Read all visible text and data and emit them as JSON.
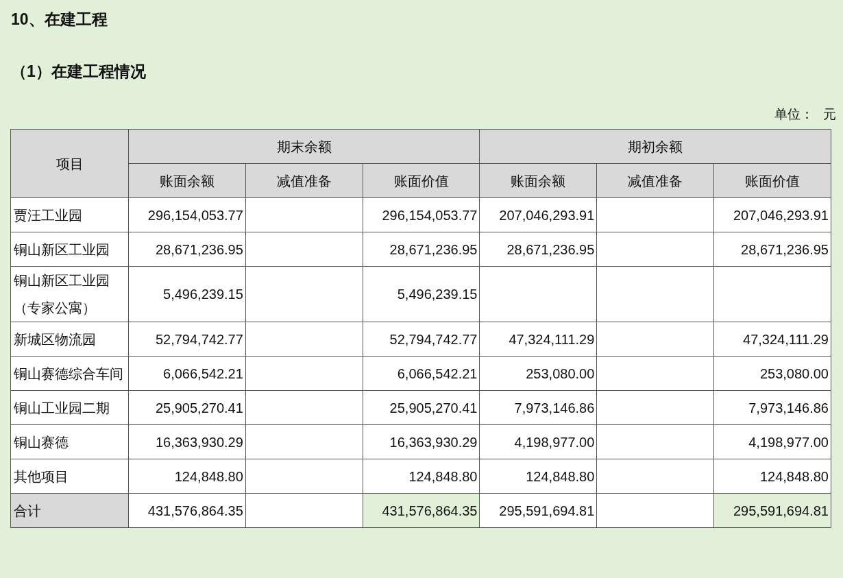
{
  "section_title": "10、在建工程",
  "subsection_title": "（1）在建工程情况",
  "unit": {
    "label": "单位：",
    "value": "元"
  },
  "table": {
    "item_header": "项目",
    "groups": [
      {
        "title": "期末余额",
        "columns": [
          "账面余额",
          "减值准备",
          "账面价值"
        ]
      },
      {
        "title": "期初余额",
        "columns": [
          "账面余额",
          "减值准备",
          "账面价值"
        ]
      }
    ],
    "rows": [
      {
        "kind": "normal",
        "item": "贾汪工业园",
        "cells": [
          "296,154,053.77",
          null,
          "296,154,053.77",
          "207,046,293.91",
          null,
          "207,046,293.91"
        ]
      },
      {
        "kind": "normal",
        "item": "铜山新区工业园",
        "cells": [
          "28,671,236.95",
          null,
          "28,671,236.95",
          "28,671,236.95",
          null,
          "28,671,236.95"
        ]
      },
      {
        "kind": "normal",
        "item": "铜山新区工业园（专家公寓）",
        "cells": [
          "5,496,239.15",
          null,
          "5,496,239.15",
          null,
          null,
          null
        ]
      },
      {
        "kind": "normal",
        "item": "新城区物流园",
        "cells": [
          "52,794,742.77",
          null,
          "52,794,742.77",
          "47,324,111.29",
          null,
          "47,324,111.29"
        ]
      },
      {
        "kind": "normal",
        "item": "铜山赛德综合车间",
        "cells": [
          "6,066,542.21",
          null,
          "6,066,542.21",
          "253,080.00",
          null,
          "253,080.00"
        ]
      },
      {
        "kind": "normal",
        "item": "铜山工业园二期",
        "cells": [
          "25,905,270.41",
          null,
          "25,905,270.41",
          "7,973,146.86",
          null,
          "7,973,146.86"
        ]
      },
      {
        "kind": "normal",
        "item": "铜山赛德",
        "cells": [
          "16,363,930.29",
          null,
          "16,363,930.29",
          "4,198,977.00",
          null,
          "4,198,977.00"
        ]
      },
      {
        "kind": "normal",
        "item": "其他项目",
        "cells": [
          "124,848.80",
          null,
          "124,848.80",
          "124,848.80",
          null,
          "124,848.80"
        ]
      },
      {
        "kind": "total",
        "item": "合计",
        "highlighted": [
          false,
          false,
          true,
          false,
          false,
          true
        ],
        "cells": [
          "431,576,864.35",
          null,
          "431,576,864.35",
          "295,591,694.81",
          null,
          "295,591,694.81"
        ]
      }
    ]
  }
}
